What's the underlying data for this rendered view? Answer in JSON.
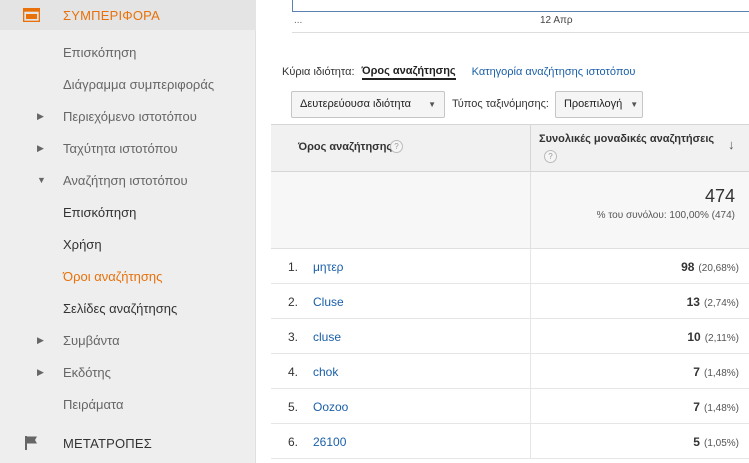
{
  "sidebar": {
    "behavior_section": {
      "label": "ΣΥΜΠΕΡΙΦΟΡΑ",
      "color": "#e8710a"
    },
    "items": [
      {
        "label": "Επισκόπηση",
        "caret": ""
      },
      {
        "label": "Διάγραμμα συμπεριφοράς",
        "caret": ""
      },
      {
        "label": "Περιεχόμενο ιστοτόπου",
        "caret": "▶"
      },
      {
        "label": "Ταχύτητα ιστοτόπου",
        "caret": "▶"
      },
      {
        "label": "Αναζήτηση ιστοτόπου",
        "caret": "▼"
      },
      {
        "label": "Επισκόπηση",
        "caret": ""
      },
      {
        "label": "Χρήση",
        "caret": ""
      },
      {
        "label": "Όροι αναζήτησης",
        "caret": ""
      },
      {
        "label": "Σελίδες αναζήτησης",
        "caret": ""
      },
      {
        "label": "Συμβάντα",
        "caret": "▶"
      },
      {
        "label": "Εκδότης",
        "caret": "▶"
      },
      {
        "label": "Πειράματα",
        "caret": ""
      }
    ],
    "conversions_section": {
      "label": "ΜΕΤΑΤΡΟΠΕΣ"
    }
  },
  "chart": {
    "ellipsis": "...",
    "date_label": "12 Απρ",
    "line_color": "#5b80b2"
  },
  "dimension_bar": {
    "label": "Κύρια ιδιότητα:",
    "current": "Όρος αναζήτησης",
    "alternate": "Κατηγορία αναζήτησης ιστοτόπου"
  },
  "toolbar": {
    "secondary_dimension": "Δευτερεύουσα ιδιότητα",
    "sort_type_label": "Τύπος ταξινόμησης:",
    "sort_type_value": "Προεπιλογή"
  },
  "table": {
    "header": {
      "dimension": "Όρος αναζήτησης",
      "metric": "Συνολικές μοναδικές αναζητήσεις",
      "help": "?",
      "sort_arrow": "↓"
    },
    "totals": {
      "value": "474",
      "percent_text": "% του συνόλου: 100,00% (474)"
    },
    "rows": [
      {
        "index": "1.",
        "term": "μητερ",
        "value": "98",
        "percent": "(20,68%)"
      },
      {
        "index": "2.",
        "term": "Cluse",
        "value": "13",
        "percent": "(2,74%)"
      },
      {
        "index": "3.",
        "term": "cluse",
        "value": "10",
        "percent": "(2,11%)"
      },
      {
        "index": "4.",
        "term": "chok",
        "value": "7",
        "percent": "(1,48%)"
      },
      {
        "index": "5.",
        "term": "Oozoo",
        "value": "7",
        "percent": "(1,48%)"
      },
      {
        "index": "6.",
        "term": "26100",
        "value": "5",
        "percent": "(1,05%)"
      }
    ]
  }
}
